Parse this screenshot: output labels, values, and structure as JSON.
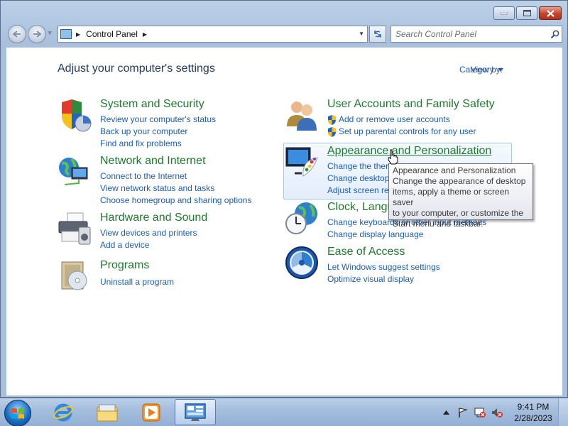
{
  "window": {
    "caption_buttons": [
      "minimize",
      "maximize",
      "close"
    ]
  },
  "navbar": {
    "address": {
      "segments": [
        "Control Panel"
      ]
    },
    "search": {
      "placeholder": "Search Control Panel"
    }
  },
  "content": {
    "title": "Adjust your computer's settings",
    "view_by": {
      "label": "View by:",
      "value": "Category"
    },
    "categories": [
      {
        "title": "System and Security",
        "icon": "shield-pie-icon",
        "links": [
          "Review your computer's status",
          "Back up your computer",
          "Find and fix problems"
        ]
      },
      {
        "title": "Network and Internet",
        "icon": "network-globe-icon",
        "links": [
          "Connect to the Internet",
          "View network status and tasks",
          "Choose homegroup and sharing options"
        ]
      },
      {
        "title": "Hardware and Sound",
        "icon": "printer-speaker-icon",
        "links": [
          "View devices and printers",
          "Add a device"
        ]
      },
      {
        "title": "Programs",
        "icon": "programs-disc-icon",
        "links": [
          "Uninstall a program"
        ]
      },
      {
        "title": "User Accounts and Family Safety",
        "icon": "users-icon",
        "links": [
          "Add or remove user accounts",
          "Set up parental controls for any user"
        ]
      },
      {
        "title": "Appearance and Personalization",
        "icon": "monitor-palette-icon",
        "links": [
          "Change the ther",
          "Change desktop",
          "Adjust screen re"
        ]
      },
      {
        "title": "Clock, Langu",
        "icon": "clock-globe-icon",
        "links": [
          "Change keyboards or other input methods",
          "Change display language"
        ]
      },
      {
        "title": "Ease of Access",
        "icon": "ease-of-access-icon",
        "links": [
          "Let Windows suggest settings",
          "Optimize visual display"
        ]
      }
    ],
    "tooltip": {
      "lines": [
        "Appearance and Personalization",
        "Change the appearance of desktop",
        "items, apply a theme or screen saver",
        "to your computer, or customize the",
        "Start menu and taskbar."
      ]
    }
  },
  "taskbar": {
    "pinned": [
      "internet-explorer-icon",
      "windows-explorer-icon",
      "media-player-icon",
      "control-panel-icon"
    ],
    "active": "control-panel-icon",
    "clock": {
      "time": "9:41 PM",
      "date": "2/28/2023"
    },
    "colors": {
      "accent": "#1e5eb0",
      "category_title": "#1e7a2e"
    }
  }
}
